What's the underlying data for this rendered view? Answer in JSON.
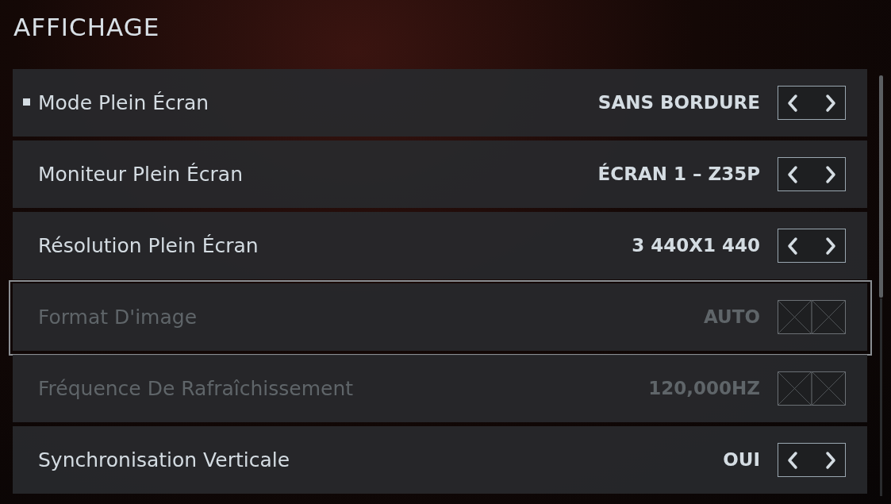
{
  "title": "AFFICHAGE",
  "settings": [
    {
      "label": "Mode Plein Écran",
      "value": "SANS BORDURE",
      "selected": true,
      "focused": false,
      "disabled": false
    },
    {
      "label": "Moniteur Plein Écran",
      "value": "ÉCRAN 1 – Z35P",
      "selected": false,
      "focused": false,
      "disabled": false
    },
    {
      "label": "Résolution Plein Écran",
      "value": "3 440X1 440",
      "selected": false,
      "focused": false,
      "disabled": false
    },
    {
      "label": "Format D'image",
      "value": "AUTO",
      "selected": false,
      "focused": true,
      "disabled": true
    },
    {
      "label": "Fréquence De Rafraîchissement",
      "value": "120,000HZ",
      "selected": false,
      "focused": false,
      "disabled": true
    },
    {
      "label": "Synchronisation Verticale",
      "value": "OUI",
      "selected": false,
      "focused": false,
      "disabled": false
    }
  ]
}
